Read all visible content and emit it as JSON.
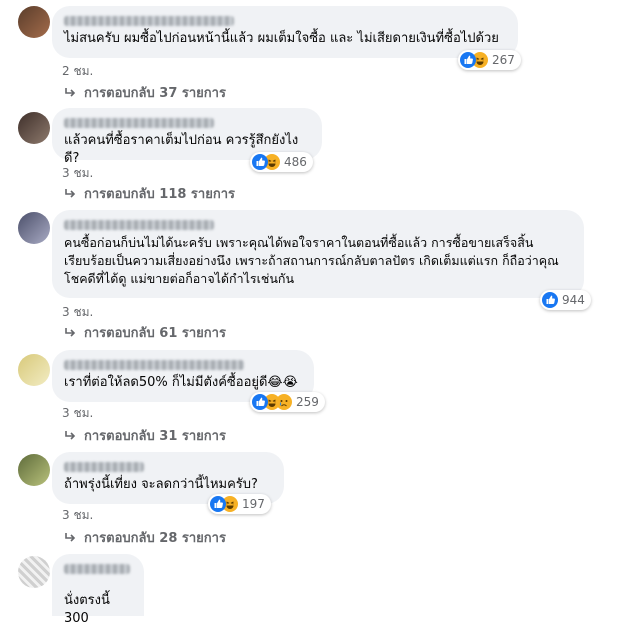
{
  "comments": [
    {
      "text": "ไม่สนครับ ผมซื้อไปก่อนหน้านี้แล้ว ผมเต็มใจซื้อ และ ไม่เสียดายเงินที่ซื้อไปด้วย",
      "reaction_count": "267",
      "reactions": [
        "like-icon",
        "haha-icon"
      ],
      "time": "2 ชม.",
      "replies": "การตอบกลับ 37 รายการ"
    },
    {
      "text": "แล้วคนที่ซื้อราคาเต็มไปก่อน ควรรู้สึกยังไงดี?",
      "reaction_count": "486",
      "reactions": [
        "like-icon",
        "haha-icon"
      ],
      "time": "3 ชม.",
      "replies": "การตอบกลับ 118 รายการ"
    },
    {
      "text": "คนซื้อก่อนก็บ่นไม่ได้นะครับ เพราะคุณได้พอใจราคาในตอนที่ซื้อแล้ว การซื้อขายเสร็จสิ้น เรียบร้อยเป็นความเสี่ยงอย่างนึง เพราะถ้าสถานการณ์กลับตาลปัตร เกิดเต็มแต่แรก ก็ถือว่าคุณโชคดีที่ได้ดู แม่ขายต่อก็อาจได้กำไรเช่นกัน",
      "reaction_count": "944",
      "reactions": [
        "like-icon"
      ],
      "time": "3 ชม.",
      "replies": "การตอบกลับ 61 รายการ"
    },
    {
      "text": "เราที่ต่อให้ลด50% ก็ไม่มีตังค์ซื้ออยู่ดี😂😭",
      "reaction_count": "259",
      "reactions": [
        "like-icon",
        "haha-icon",
        "sad-icon"
      ],
      "time": "3 ชม.",
      "replies": "การตอบกลับ 31 รายการ"
    },
    {
      "text": "ถ้าพรุ่งนี้เที่ยง จะลดกว่านี้ไหมครับ?",
      "reaction_count": "197",
      "reactions": [
        "like-icon",
        "haha-icon"
      ],
      "time": "3 ชม.",
      "replies": "การตอบกลับ 28 รายการ"
    },
    {
      "text": "นั่งตรงนี้ 300"
    }
  ],
  "colors": {
    "bubble": "#f0f2f5",
    "meta": "#65676b",
    "like": "#1877f2",
    "haha": "#f7b125"
  }
}
